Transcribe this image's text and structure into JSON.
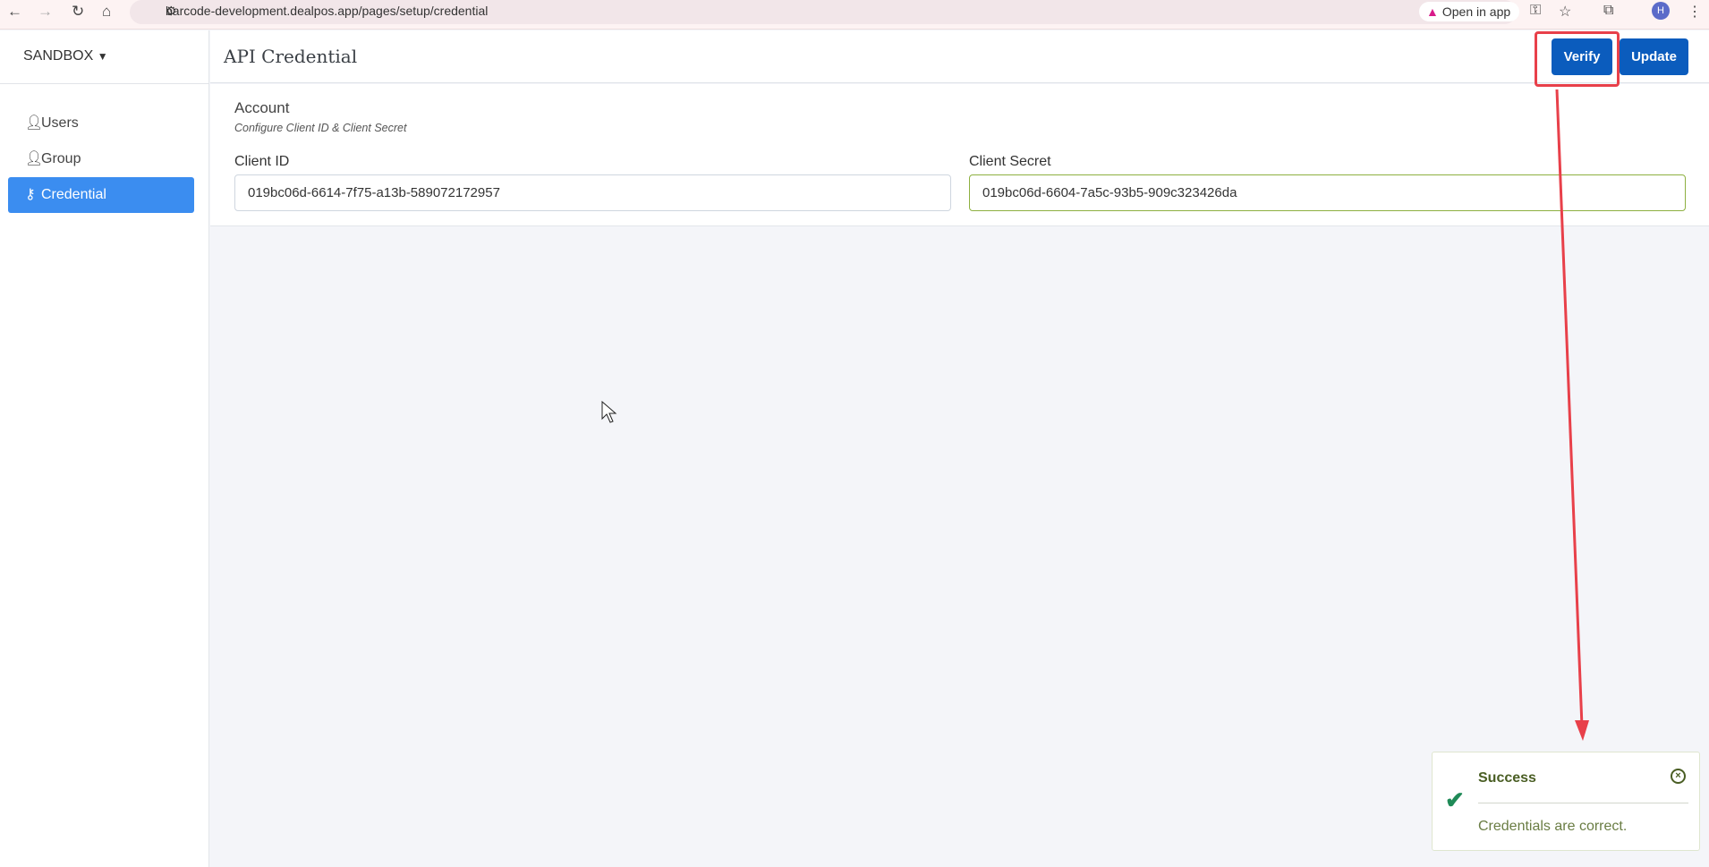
{
  "browser": {
    "url": "barcode-development.dealpos.app/pages/setup/credential",
    "open_in_app": "Open in app",
    "avatar_initial": "H"
  },
  "sidebar": {
    "brand": "SANDBOX",
    "items": [
      {
        "label": "Users"
      },
      {
        "label": "Group"
      },
      {
        "label": "Credential"
      }
    ]
  },
  "header": {
    "title": "API Credential",
    "verify": "Verify",
    "update": "Update"
  },
  "account": {
    "title": "Account",
    "subtitle": "Configure Client ID & Client Secret",
    "client_id_label": "Client ID",
    "client_id": "019bc06d-6614-7f75-a13b-589072172957",
    "client_secret_label": "Client Secret",
    "client_secret": "019bc06d-6604-7a5c-93b5-909c323426da"
  },
  "toast": {
    "title": "Success",
    "message": "Credentials are correct."
  },
  "colors": {
    "primary": "#0b5cbd",
    "active": "#3b8df0",
    "annotation": "#e8404a",
    "success": "#1f8a57"
  }
}
